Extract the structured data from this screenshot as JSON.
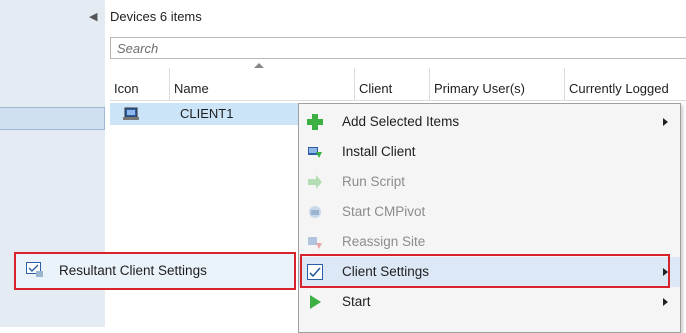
{
  "nav": {
    "collapse_icon": "chevron-left-icon"
  },
  "header": {
    "title": "Devices 6 items"
  },
  "search": {
    "placeholder": "Search"
  },
  "table": {
    "columns": [
      "Icon",
      "Name",
      "Client",
      "Primary User(s)",
      "Currently Logged"
    ],
    "rows": [
      {
        "icon": "computer-icon",
        "name": "CLIENT1"
      }
    ]
  },
  "context_menu": {
    "items": [
      {
        "label": "Add Selected Items",
        "icon": "plus-icon",
        "disabled": false,
        "submenu": true
      },
      {
        "label": "Install Client",
        "icon": "install-client-icon",
        "disabled": false,
        "submenu": false
      },
      {
        "label": "Run Script",
        "icon": "run-script-arrow-icon",
        "disabled": true,
        "submenu": false
      },
      {
        "label": "Start CMPivot",
        "icon": "cmpivot-icon",
        "disabled": true,
        "submenu": false
      },
      {
        "label": "Reassign Site",
        "icon": "reassign-site-icon",
        "disabled": true,
        "submenu": false
      },
      {
        "label": "Client Settings",
        "icon": "client-settings-icon",
        "disabled": false,
        "submenu": true
      },
      {
        "label": "Start",
        "icon": "play-icon",
        "disabled": false,
        "submenu": true
      }
    ]
  },
  "submenu": {
    "item": {
      "label": "Resultant Client Settings",
      "icon": "resultant-settings-icon"
    }
  },
  "colors": {
    "highlight": "#d8232a",
    "selection": "#cce4f7",
    "nav_bg": "#e4ebf3"
  }
}
